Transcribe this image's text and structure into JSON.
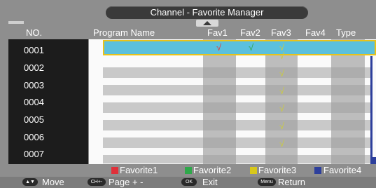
{
  "title": "Channel - Favorite Manager",
  "header": {
    "no": "NO.",
    "program_name": "Program Name",
    "fav1": "Fav1",
    "fav2": "Fav2",
    "fav3": "Fav3",
    "fav4": "Fav4",
    "type": "Type"
  },
  "rows": [
    {
      "no": "0001",
      "fav1": "√",
      "fav2": "√",
      "fav3": "√"
    },
    {
      "no": "0002",
      "fav3": "√"
    },
    {
      "no": "0003",
      "fav3": "√"
    },
    {
      "no": "0004",
      "fav3": "√"
    },
    {
      "no": "0005",
      "fav3": "√"
    },
    {
      "no": "0006",
      "fav3": "√"
    },
    {
      "no": "0007",
      "fav3": "√"
    }
  ],
  "legend": [
    {
      "label": "Favorite1",
      "color": "#e0303a"
    },
    {
      "label": "Favorite2",
      "color": "#2ea84a"
    },
    {
      "label": "Favorite3",
      "color": "#d8c81a"
    },
    {
      "label": "Favorite4",
      "color": "#2d3f9c"
    }
  ],
  "hints": {
    "move_key": "▲▼",
    "move": "Move",
    "page_key": "CH+-",
    "page": "Page + -",
    "exit_key": "OK",
    "exit": "Exit",
    "return_key": "Menu",
    "return": "Return"
  }
}
